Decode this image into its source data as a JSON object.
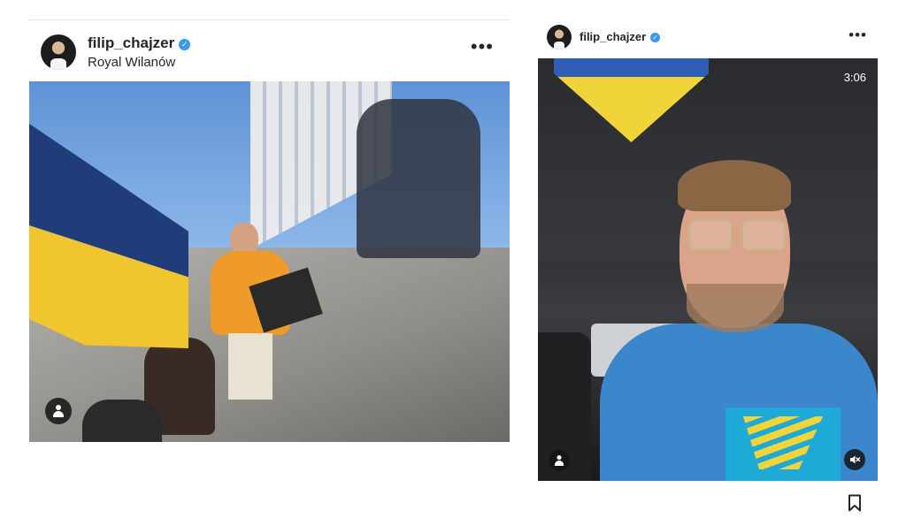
{
  "left_post": {
    "username": "filip_chajzer",
    "location": "Royal Wilanów",
    "more": "•••",
    "verified": "✓"
  },
  "right_post": {
    "username": "filip_chajzer",
    "more": "•••",
    "verified": "✓",
    "video_duration": "3:06"
  },
  "icons": {
    "verified": "verified-badge-icon",
    "tag": "tagged-user-icon",
    "mute": "muted-speaker-icon",
    "save": "bookmark-icon"
  },
  "colors": {
    "verified_blue": "#3897f0",
    "flag_blue": "#203d7a",
    "flag_yellow": "#f0c52d"
  }
}
